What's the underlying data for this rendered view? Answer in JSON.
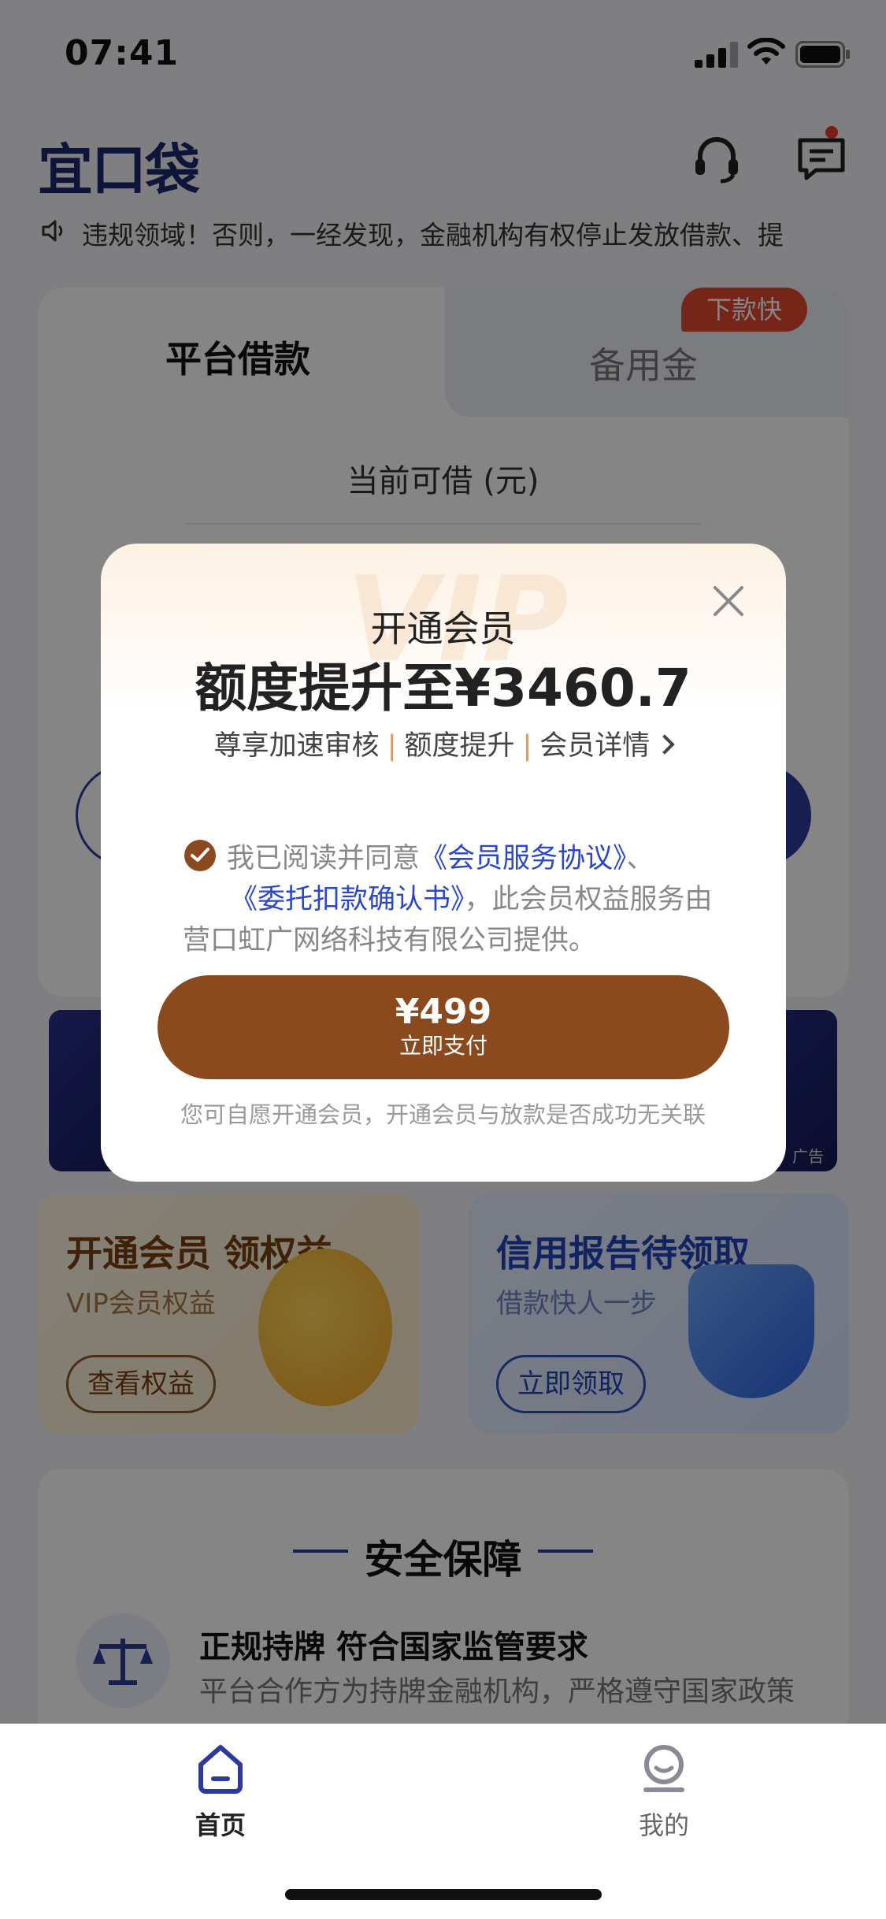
{
  "status_bar": {
    "time": "07:41"
  },
  "header": {
    "logo_text": "宜口袋"
  },
  "notice": {
    "text": "违规领域！否则，一经发现，金融机构有权停止发放借款、提"
  },
  "loan_card": {
    "tab_main": "平台借款",
    "tab_alt": "备用金",
    "badge": "下款快",
    "available_label": "当前可借 (元)"
  },
  "banner": {
    "ad_label": "广告"
  },
  "promos": {
    "vip": {
      "title": "开通会员 领权益",
      "subtitle": "VIP会员权益",
      "button": "查看权益"
    },
    "credit": {
      "title": "信用报告待领取",
      "subtitle": "借款快人一步",
      "button": "立即领取"
    }
  },
  "safety": {
    "title": "安全保障",
    "item_title": "正规持牌 符合国家监管要求",
    "item_desc": "平台合作方为持牌金融机构，严格遵守国家政策"
  },
  "tabbar": {
    "home": "首页",
    "mine": "我的"
  },
  "modal": {
    "watermark": "VIP",
    "subtitle": "开通会员",
    "title": "额度提升至¥3460.7",
    "features": [
      "尊享加速审核",
      "额度提升",
      "会员详情"
    ],
    "agree_prefix": "我已阅读并同意",
    "link1": "《会员服务协议》",
    "agree_mid": "、",
    "link2": "《委托扣款确认书》",
    "agree_suffix": "，此会员权益服务由营口虹广网络科技有限公司提供。",
    "price": "¥499",
    "pay_action": "立即支付",
    "disclaimer": "您可自愿开通会员，开通会员与放款是否成功无关联"
  },
  "colors": {
    "brand": "#2d3a9c",
    "accent_brown": "#8b4a1d",
    "link_blue": "#2a48c8",
    "badge_red": "#e24a2e"
  }
}
